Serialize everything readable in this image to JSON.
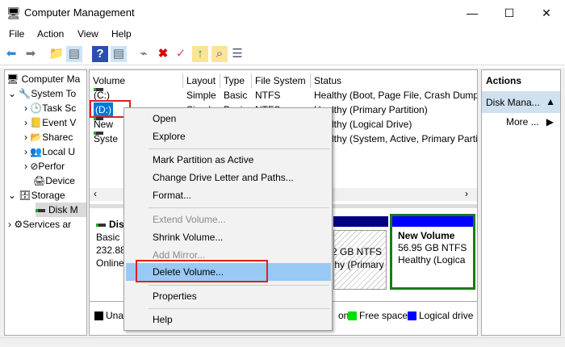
{
  "window": {
    "title": "Computer Management",
    "minimize": "—",
    "maximize": "☐",
    "close": "✕"
  },
  "menubar": [
    "File",
    "Action",
    "View",
    "Help"
  ],
  "toolbar": {
    "icons": [
      "back-arrow",
      "forward-arrow",
      "up-folder",
      "show-hide-tree",
      "help",
      "show-hide-action",
      "connect",
      "delete",
      "properties",
      "export",
      "find",
      "list"
    ]
  },
  "tree": {
    "items": [
      {
        "label": "Computer Ma",
        "level": 0,
        "expander": ""
      },
      {
        "label": "System To",
        "level": 1,
        "expander": "⌄"
      },
      {
        "label": "Task Sc",
        "level": 2,
        "expander": "›"
      },
      {
        "label": "Event V",
        "level": 2,
        "expander": "›"
      },
      {
        "label": "Sharec",
        "level": 2,
        "expander": "›"
      },
      {
        "label": "Local U",
        "level": 2,
        "expander": "›"
      },
      {
        "label": "Perfor",
        "level": 2,
        "expander": "›"
      },
      {
        "label": "Device",
        "level": 2,
        "expander": ""
      },
      {
        "label": "Storage",
        "level": 1,
        "expander": "⌄"
      },
      {
        "label": "Disk M",
        "level": 2,
        "expander": ""
      },
      {
        "label": "Services ar",
        "level": 1,
        "expander": "›"
      }
    ]
  },
  "table": {
    "columns": [
      "Volume",
      "Layout",
      "Type",
      "File System",
      "Status"
    ],
    "rows": [
      {
        "volume": "(C:)",
        "layout": "Simple",
        "type": "Basic",
        "fs": "NTFS",
        "status": "Healthy (Boot, Page File, Crash Dump"
      },
      {
        "volume": "(D:)",
        "layout": "Simple",
        "type": "Basic",
        "fs": "NTFS",
        "status": "Healthy (Primary Partition)"
      },
      {
        "volume": "New",
        "layout": "",
        "type": "",
        "fs": "",
        "status": "Healthy (Logical Drive)"
      },
      {
        "volume": "Syste",
        "layout": "",
        "type": "",
        "fs": "",
        "status": "Healthy (System, Active, Primary Parti"
      }
    ]
  },
  "disk": {
    "name": "Dis",
    "type": "Basic",
    "size": "232.88",
    "state": "Online",
    "partition_mid": {
      "fs": "2 GB NTFS",
      "status": "thy (Primary"
    },
    "partition_new": {
      "name": "New Volume",
      "fs": "56.95 GB NTFS",
      "status": "Healthy (Logica"
    }
  },
  "legend": [
    {
      "label": "Una",
      "color": "#000000"
    },
    {
      "label": "on",
      "color": "#000080"
    },
    {
      "label": "Free space",
      "color": "#00e000"
    },
    {
      "label": "Logical drive",
      "color": "#0000ff"
    }
  ],
  "actions": {
    "header": "Actions",
    "section": "Disk Mana...",
    "more": "More ..."
  },
  "context_menu": {
    "items": [
      {
        "label": "Open",
        "disabled": false
      },
      {
        "label": "Explore",
        "disabled": false
      },
      {
        "label": "Mark Partition as Active",
        "disabled": false
      },
      {
        "label": "Change Drive Letter and Paths...",
        "disabled": false
      },
      {
        "label": "Format...",
        "disabled": false
      },
      {
        "label": "Extend Volume...",
        "disabled": true
      },
      {
        "label": "Shrink Volume...",
        "disabled": false
      },
      {
        "label": "Add Mirror...",
        "disabled": true
      },
      {
        "label": "Delete Volume...",
        "disabled": false,
        "highlighted": true
      },
      {
        "label": "Properties",
        "disabled": false
      },
      {
        "label": "Help",
        "disabled": false
      }
    ]
  },
  "colors": {
    "highlight": "#99c9f5",
    "annotation": "#e02020",
    "selection": "#0078d7",
    "new_volume_border": "#1a7a1a"
  }
}
